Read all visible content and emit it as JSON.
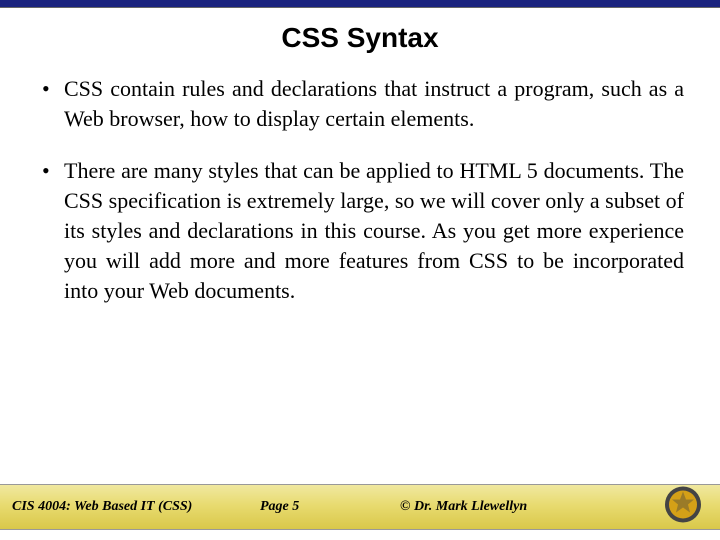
{
  "title": "CSS Syntax",
  "bullets": [
    "CSS contain rules and declarations that instruct a program, such as a Web browser, how to display certain elements.",
    "There are many styles that can be applied to HTML 5 documents.  The CSS specification is extremely large, so we will cover only a subset of its styles and declarations in this course.   As you get more experience you will add more and more features from CSS to be incorporated into your Web documents."
  ],
  "footer": {
    "course": "CIS 4004: Web Based IT (CSS)",
    "page": "Page 5",
    "copyright": "© Dr. Mark Llewellyn"
  },
  "colors": {
    "topbar": "#1a237e",
    "gradient_top": "#f0e8a0",
    "gradient_bottom": "#d9c84a",
    "logo_outer": "#444444",
    "logo_gold": "#d4a017"
  }
}
